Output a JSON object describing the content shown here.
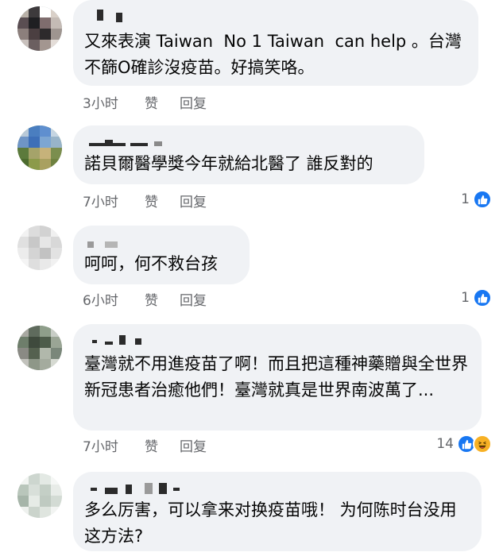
{
  "comments": [
    {
      "text": "又來表演 Taiwan  No 1 Taiwan  can help 。台灣不篩O確診沒疫苗。好搞笑咯。",
      "time": "3小时",
      "like": "赞",
      "reply": "回复",
      "reaction_count": ""
    },
    {
      "text": "諾貝爾醫學獎今年就給北醫了 誰反對的",
      "time": "7小时",
      "like": "赞",
      "reply": "回复",
      "reaction_count": "1"
    },
    {
      "text": "呵呵，何不救台孩",
      "time": "6小时",
      "like": "赞",
      "reply": "回复",
      "reaction_count": "1"
    },
    {
      "text": "臺灣就不用進疫苗了啊！而且把這種神藥贈與全世界新冠患者治癒他們！臺灣就真是世界南波萬了...",
      "time": "7小时",
      "like": "赞",
      "reply": "回复",
      "reaction_count": "14"
    },
    {
      "text": "多么厉害，可以拿来对换疫苗哦！ 为何陈时台没用这方法?",
      "time": "",
      "like": "",
      "reply": "",
      "reaction_count": ""
    }
  ],
  "icons": {
    "like": "thumbs-up-icon",
    "haha": "laughing-face-icon"
  },
  "colors": {
    "bubble": "#f0f2f5",
    "meta_text": "#65676b",
    "like_blue": "#1877f2",
    "haha_yellow": "#f7b125"
  }
}
